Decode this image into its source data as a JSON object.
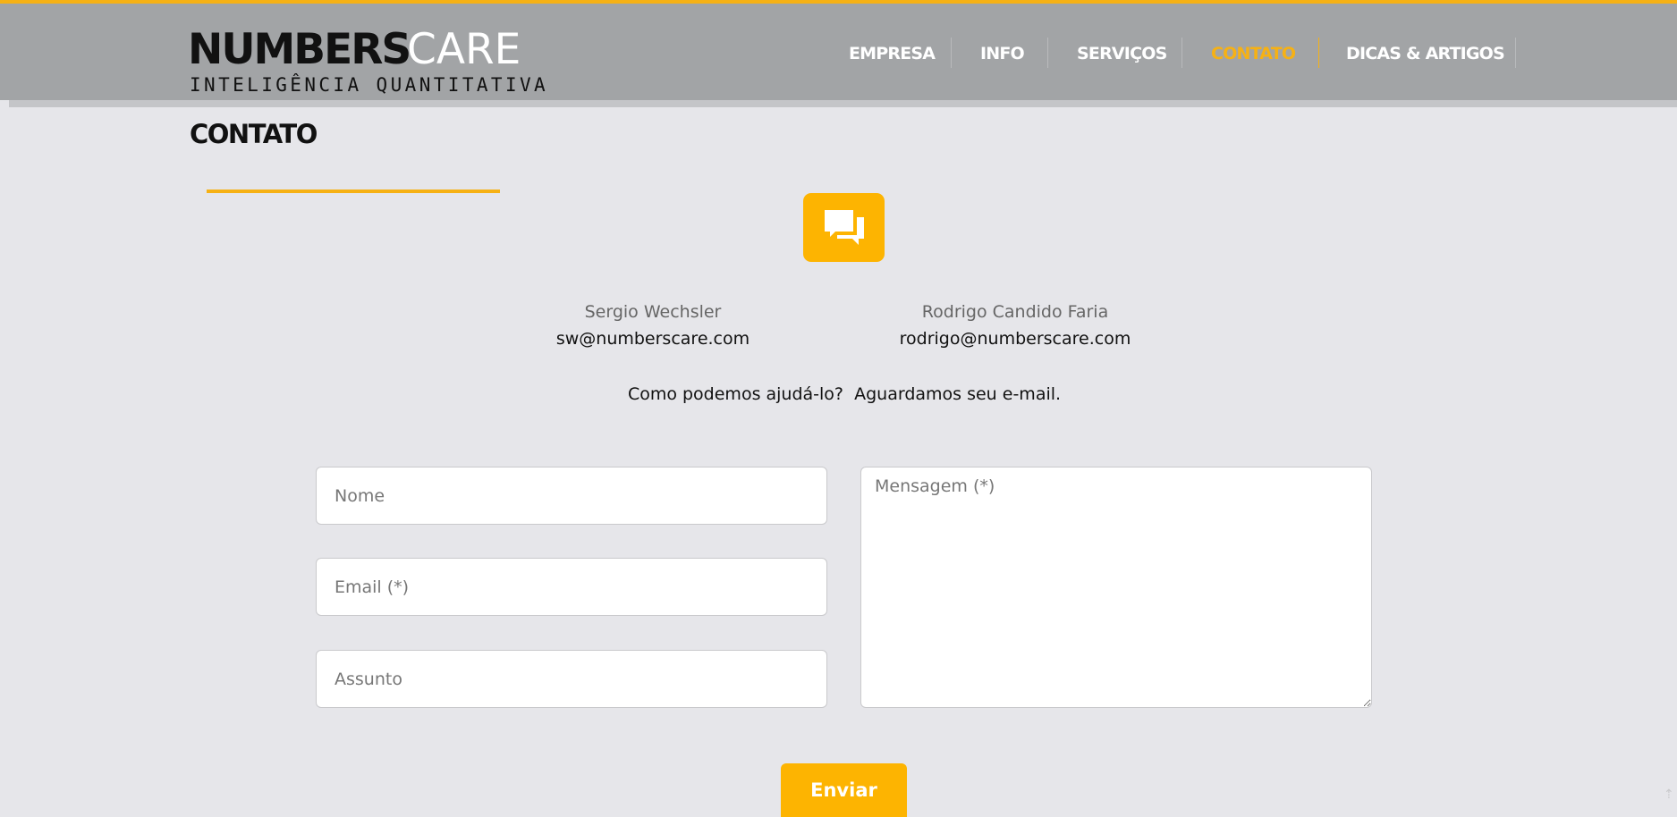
{
  "colors": {
    "accent": "#f6b115",
    "header_bg": "#a2a4a6",
    "page_bg": "#e6e6ea"
  },
  "logo": {
    "numbers": "NUMBERS",
    "care": "CARE",
    "tagline": "INTELIGÊNCIA QUANTITATIVA"
  },
  "nav": {
    "items": [
      {
        "label": "EMPRESA",
        "active": false
      },
      {
        "label": "INFO",
        "active": false
      },
      {
        "label": "SERVIÇOS",
        "active": false
      },
      {
        "label": "CONTATO",
        "active": true
      },
      {
        "label": "DICAS & ARTIGOS",
        "active": false
      }
    ]
  },
  "page": {
    "title": "CONTATO",
    "icon": "chat-bubbles-icon"
  },
  "contacts": [
    {
      "name": "Sergio Wechsler",
      "email": "sw@numberscare.com"
    },
    {
      "name": "Rodrigo Candido Faria",
      "email": "rodrigo@numberscare.com"
    }
  ],
  "help_text": "Como podemos ajudá-lo?  Aguardamos seu e-mail.",
  "form": {
    "name_placeholder": "Nome",
    "email_placeholder": "Email (*)",
    "subject_placeholder": "Assunto",
    "message_placeholder": "Mensagem (*)",
    "submit_label": "Enviar"
  },
  "scroll_top_icon": "arrow-up-icon"
}
